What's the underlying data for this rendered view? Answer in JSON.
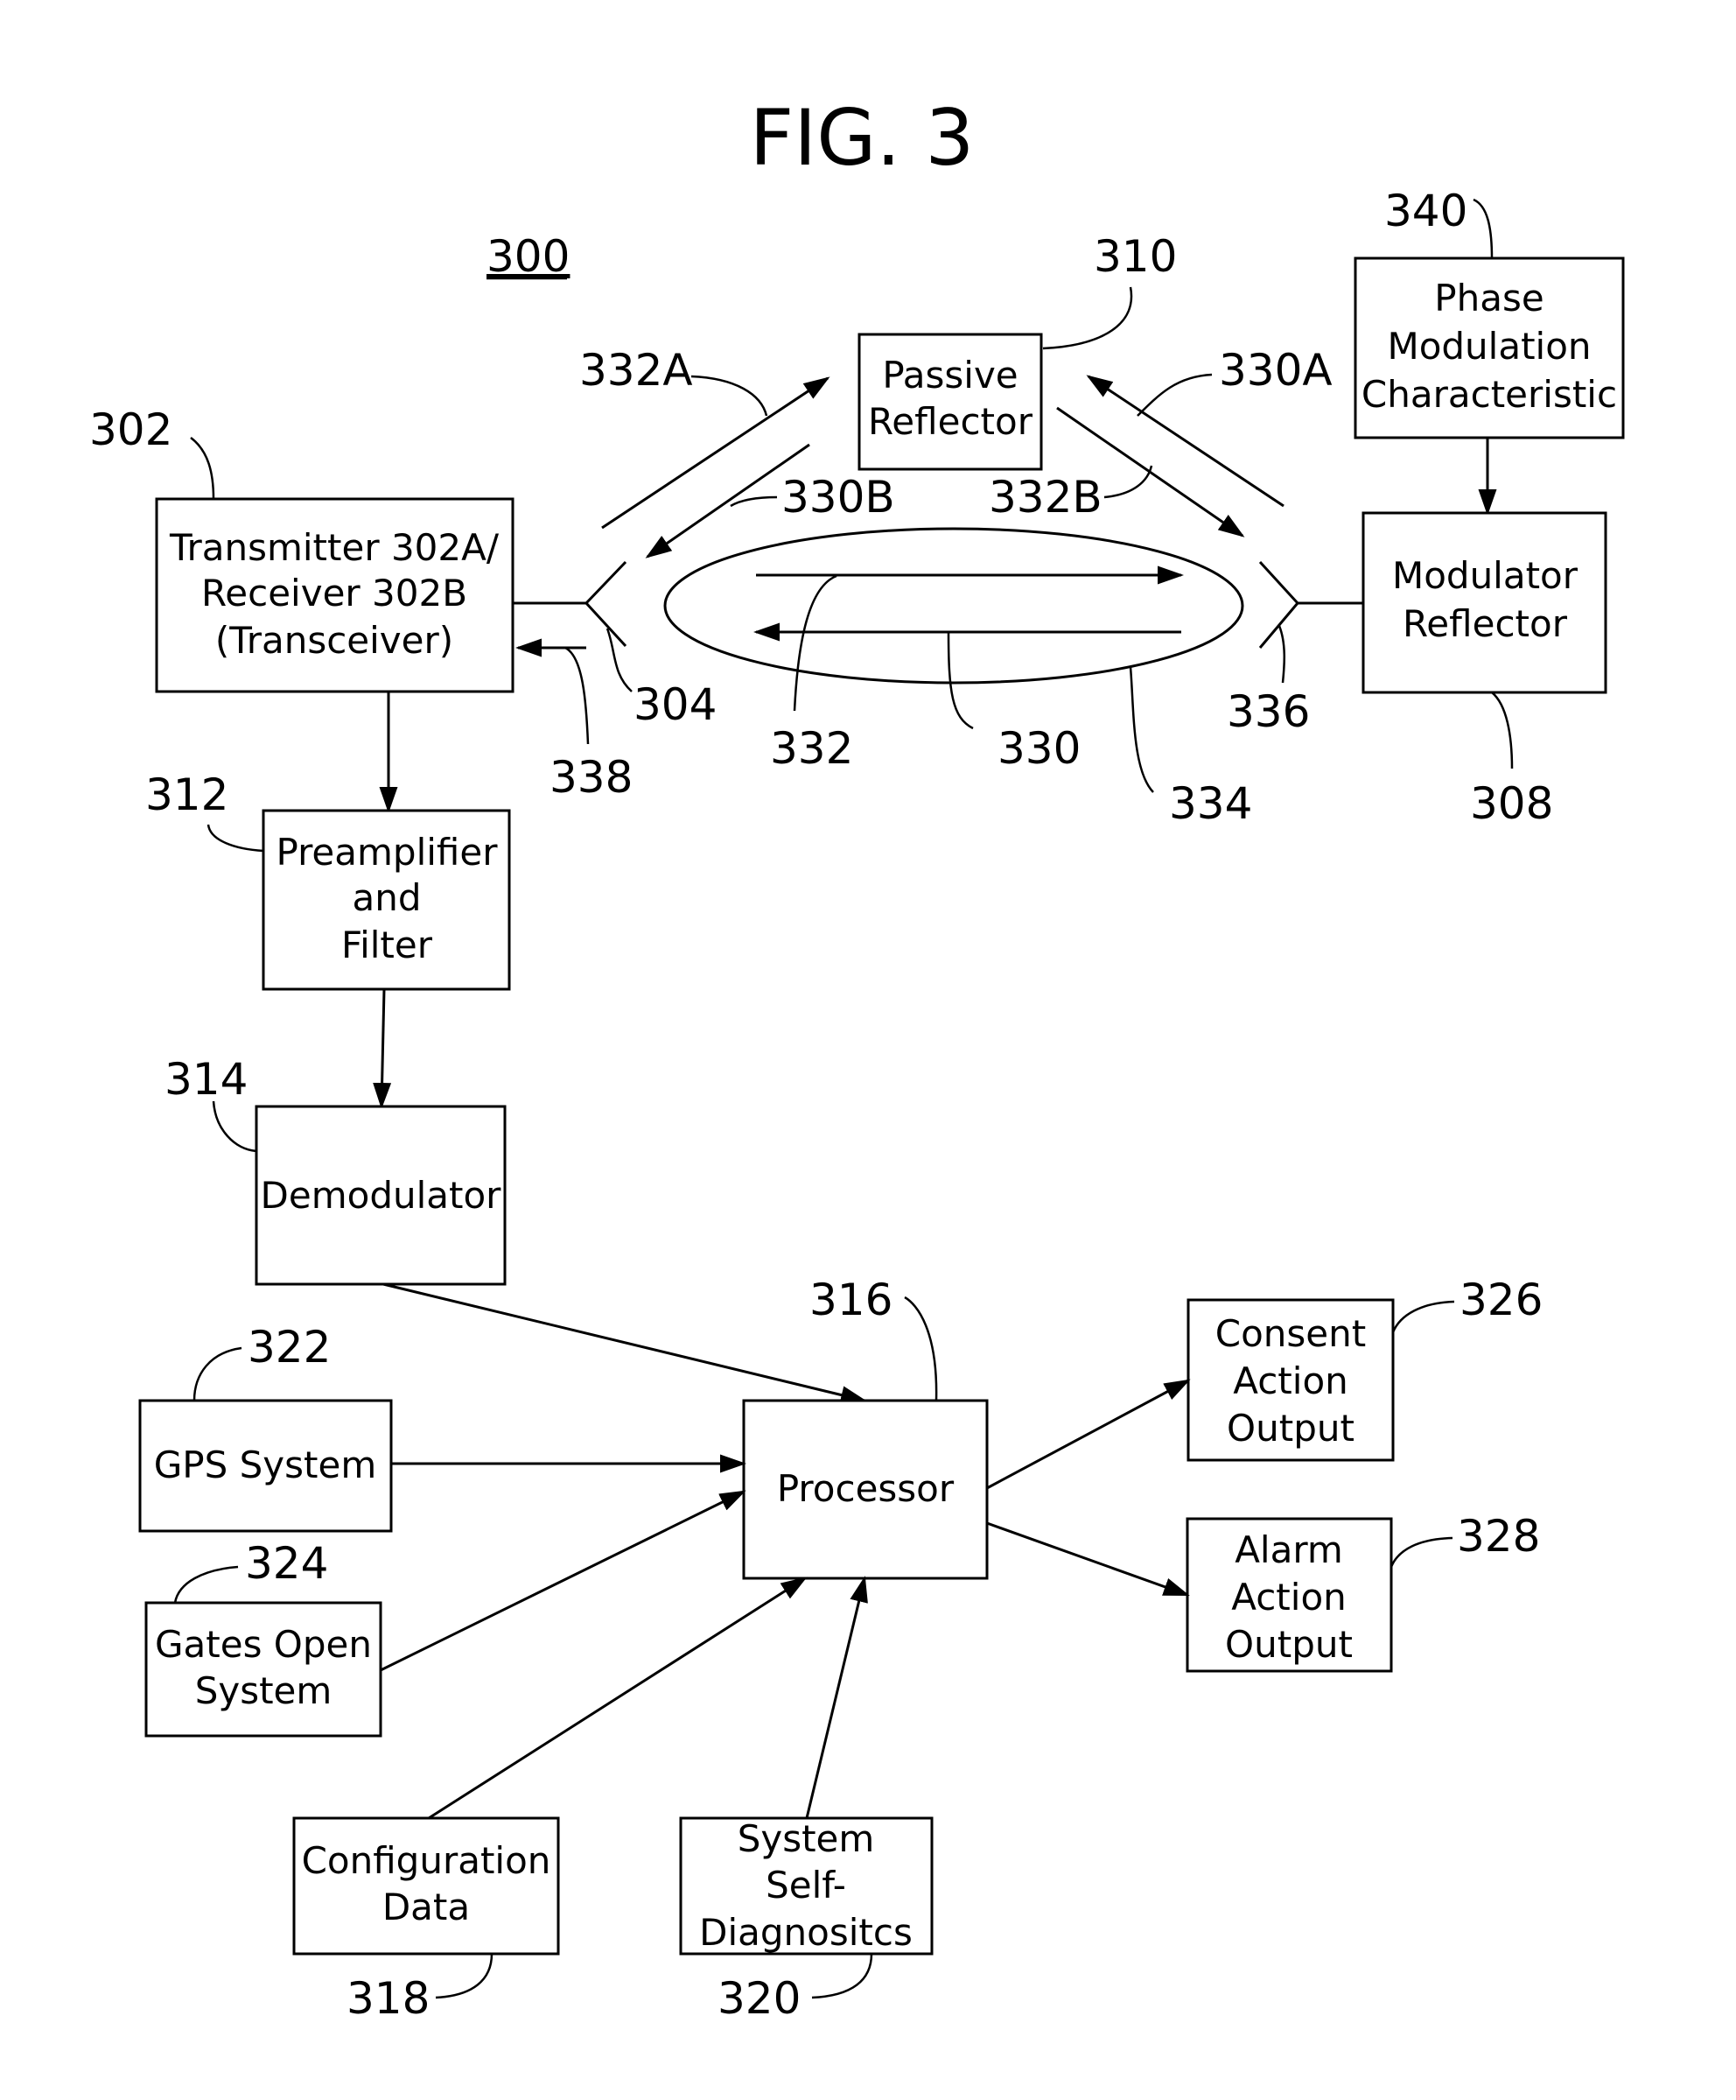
{
  "figure": {
    "title": "FIG. 3",
    "system_ref": "300"
  },
  "blocks": {
    "transceiver": {
      "lines": [
        "Transmitter 302A/",
        "Receiver 302B",
        "(Transceiver)"
      ],
      "ref": "302"
    },
    "passive_reflector": {
      "lines": [
        "Passive",
        "Reflector"
      ],
      "ref": "310"
    },
    "phase_modulation": {
      "lines": [
        "Phase",
        "Modulation",
        "Characteristic"
      ],
      "ref": "340"
    },
    "modulator_reflector": {
      "lines": [
        "Modulator",
        "Reflector"
      ],
      "ref": "308"
    },
    "preamplifier": {
      "lines": [
        "Preamplifier",
        "and",
        "Filter"
      ],
      "ref": "312"
    },
    "demodulator": {
      "lines": [
        "Demodulator"
      ],
      "ref": "314"
    },
    "processor": {
      "lines": [
        "Processor"
      ],
      "ref": "316"
    },
    "gps": {
      "lines": [
        "GPS System"
      ],
      "ref": "322"
    },
    "gates_open": {
      "lines": [
        "Gates Open",
        "System"
      ],
      "ref": "324"
    },
    "configuration": {
      "lines": [
        "Configuration",
        "Data"
      ],
      "ref": "318"
    },
    "self_diagnostics": {
      "lines": [
        "System",
        "Self-",
        "Diagnositcs"
      ],
      "ref": "320"
    },
    "consent_output": {
      "lines": [
        "Consent",
        "Action",
        "Output"
      ],
      "ref": "326"
    },
    "alarm_output": {
      "lines": [
        "Alarm",
        "Action",
        "Output"
      ],
      "ref": "328"
    }
  },
  "signal_refs": {
    "antenna_left": "304",
    "antenna_right": "336",
    "link_ellipse": "334",
    "forward_signal": "332",
    "return_signal": "330",
    "signal_332A": "332A",
    "signal_330A": "330A",
    "signal_330B": "330B",
    "signal_332B": "332B",
    "receive_path": "338"
  }
}
